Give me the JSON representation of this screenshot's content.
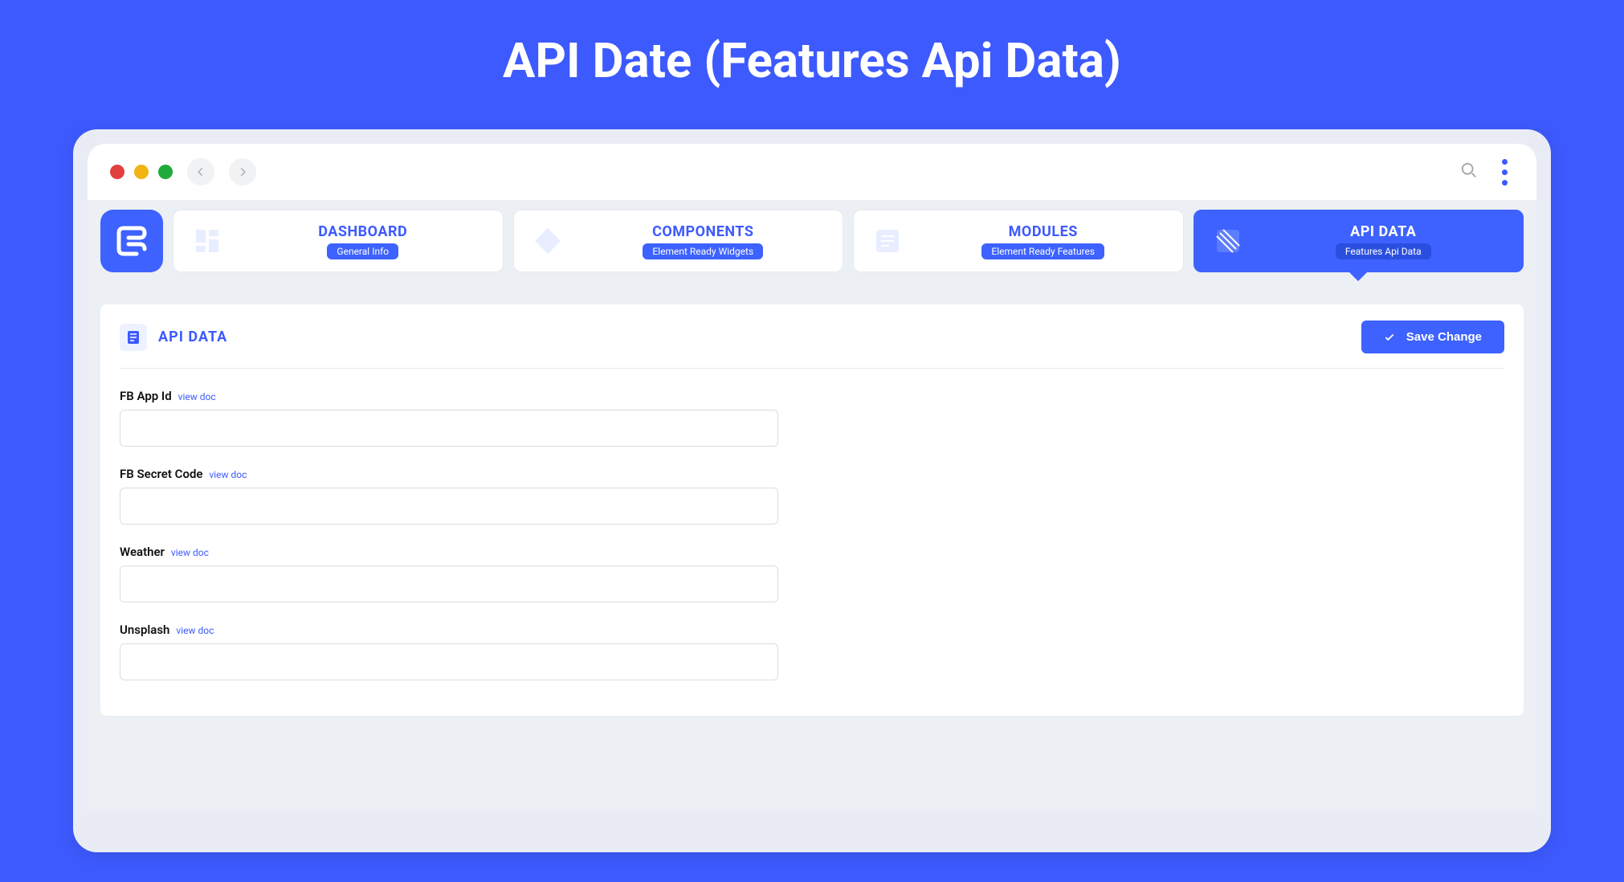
{
  "page_heading": "API Date (Features Api Data)",
  "nav": {
    "items": [
      {
        "title": "DASHBOARD",
        "badge": "General Info"
      },
      {
        "title": "COMPONENTS",
        "badge": "Element Ready Widgets"
      },
      {
        "title": "MODULES",
        "badge": "Element Ready Features"
      },
      {
        "title": "API DATA",
        "badge": "Features Api Data"
      }
    ]
  },
  "panel": {
    "title": "API DATA",
    "save_label": "Save Change"
  },
  "fields": [
    {
      "label": "FB App Id",
      "doc": "view doc",
      "value": ""
    },
    {
      "label": "FB Secret Code",
      "doc": "view doc",
      "value": ""
    },
    {
      "label": "Weather",
      "doc": "view doc",
      "value": ""
    },
    {
      "label": "Unsplash",
      "doc": "view doc",
      "value": ""
    }
  ]
}
